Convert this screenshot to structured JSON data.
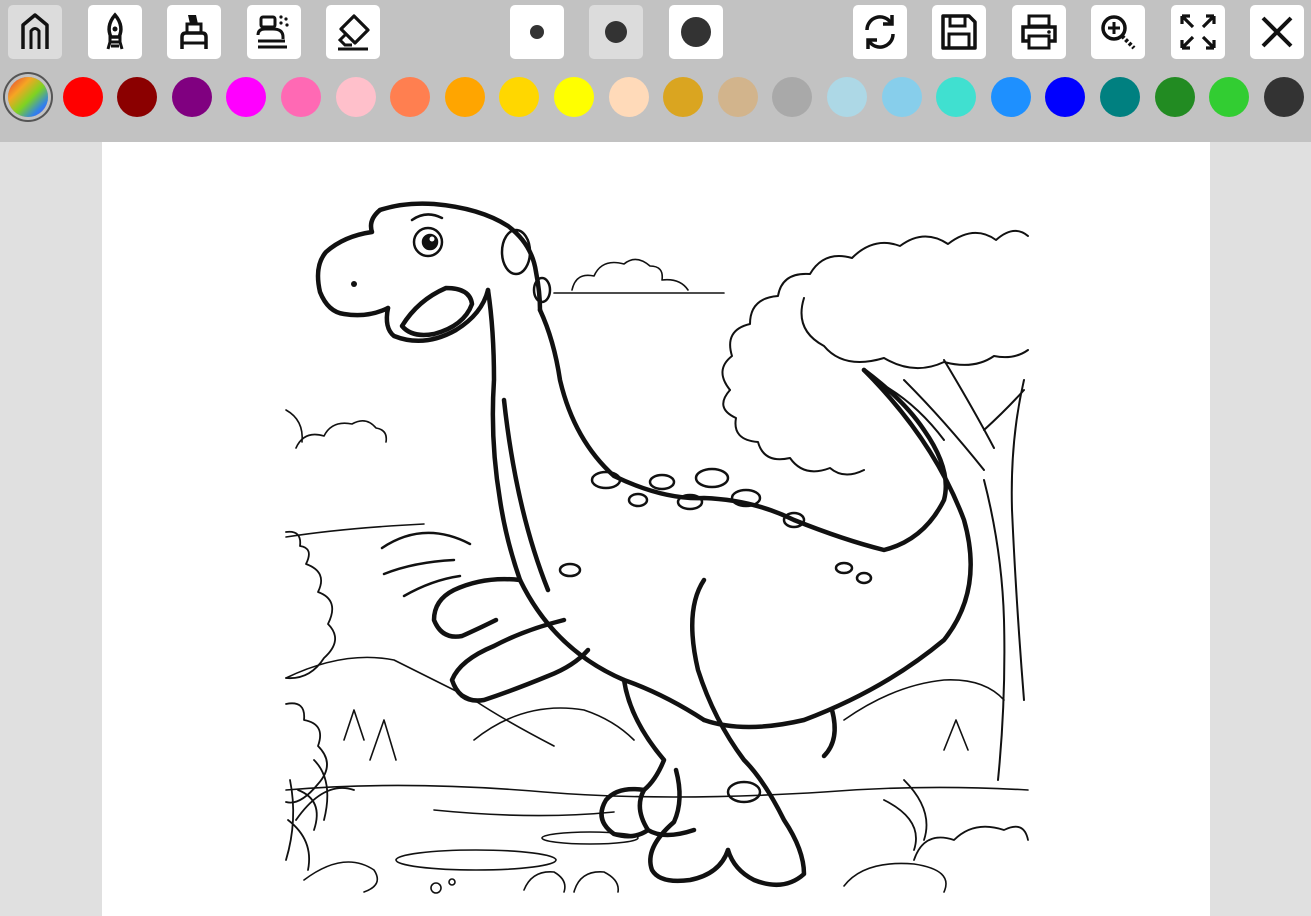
{
  "toolbar": {
    "tools": [
      {
        "name": "pencil-tool-button",
        "icon": "pencil-icon",
        "active": true
      },
      {
        "name": "brush-tool-button",
        "icon": "brush-icon",
        "active": false
      },
      {
        "name": "marker-tool-button",
        "icon": "marker-icon",
        "active": false
      },
      {
        "name": "spray-tool-button",
        "icon": "spray-icon",
        "active": false
      },
      {
        "name": "eraser-tool-button",
        "icon": "eraser-icon",
        "active": false
      }
    ],
    "brush_sizes": [
      {
        "name": "brush-size-small-button",
        "size": "small",
        "active": false
      },
      {
        "name": "brush-size-medium-button",
        "size": "medium",
        "active": true
      },
      {
        "name": "brush-size-large-button",
        "size": "large",
        "active": false
      }
    ],
    "actions": [
      {
        "name": "reset-button",
        "icon": "refresh-icon"
      },
      {
        "name": "save-button",
        "icon": "floppy-disk-icon"
      },
      {
        "name": "print-button",
        "icon": "printer-icon"
      },
      {
        "name": "zoom-in-button",
        "icon": "zoom-in-icon"
      },
      {
        "name": "fullscreen-button",
        "icon": "fullscreen-icon"
      },
      {
        "name": "close-button",
        "icon": "close-icon"
      }
    ]
  },
  "palette": {
    "selected_index": 0,
    "colors": [
      "rainbow",
      "#ff0000",
      "#8b0000",
      "#800080",
      "#ff00ff",
      "#ff69b4",
      "#ffc0cb",
      "#ff7f50",
      "#ffa500",
      "#ffd700",
      "#ffff00",
      "#ffdab9",
      "#daa520",
      "#d2b48c",
      "#a9a9a9",
      "#add8e6",
      "#87ceeb",
      "#40e0d0",
      "#1e90ff",
      "#0000ff",
      "#008080",
      "#228b22",
      "#32cd32",
      "#333333"
    ]
  },
  "canvas": {
    "subject": "dinosaur-coloring-page"
  }
}
